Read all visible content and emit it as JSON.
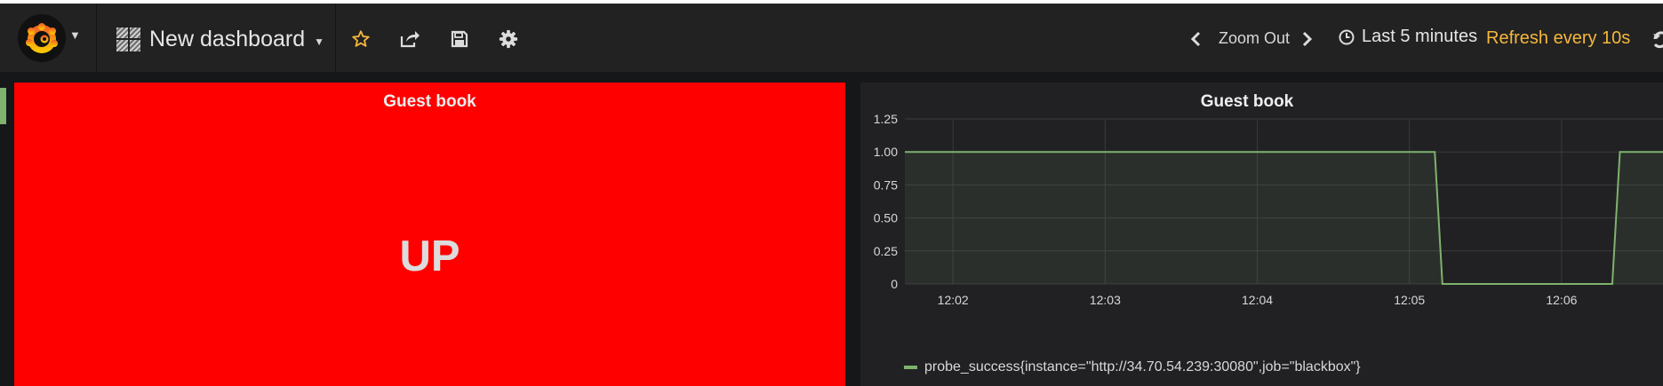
{
  "colors": {
    "navbar_bg": "#222222",
    "content_bg": "#161719",
    "panel_bg": "#212124",
    "stat_bg": "#ff0000",
    "accent": "#f5b73b",
    "series": "#7eb26d"
  },
  "navbar": {
    "logo_icon": "grafana-logo-icon",
    "dashboard_icon": "dashboard-grid-icon",
    "dashboard_title": "New dashboard",
    "star_icon": "star-icon",
    "share_icon": "share-icon",
    "save_icon": "save-icon",
    "settings_icon": "gear-icon",
    "zoom_out_label": "Zoom Out",
    "time_icon": "clock-icon",
    "time_range": "Last 5 minutes",
    "refresh_label": "Refresh every 10s"
  },
  "panels": {
    "stat": {
      "title": "Guest book",
      "value": "UP"
    },
    "graph": {
      "title": "Guest book"
    }
  },
  "chart_data": {
    "type": "line",
    "title": "Guest book",
    "xlabel": "",
    "ylabel": "",
    "x_ticks": [
      "12:02",
      "12:03",
      "12:04",
      "12:05",
      "12:06"
    ],
    "y_ticks": [
      "1.25",
      "1.00",
      "0.75",
      "0.50",
      "0.25",
      "0"
    ],
    "ylim": [
      0,
      1.25
    ],
    "xlim": [
      "12:01:41",
      "12:06:40"
    ],
    "grid": true,
    "legend_position": "bottom-left",
    "series": [
      {
        "name": "probe_success{instance=\"http://34.70.54.239:30080\",job=\"blackbox\"}",
        "color": "#7eb26d",
        "fill": true,
        "points": [
          {
            "t": "12:01:41",
            "v": 1
          },
          {
            "t": "12:05:10",
            "v": 1
          },
          {
            "t": "12:05:13",
            "v": 0
          },
          {
            "t": "12:06:20",
            "v": 0
          },
          {
            "t": "12:06:23",
            "v": 1
          },
          {
            "t": "12:06:40",
            "v": 1
          }
        ]
      }
    ]
  }
}
